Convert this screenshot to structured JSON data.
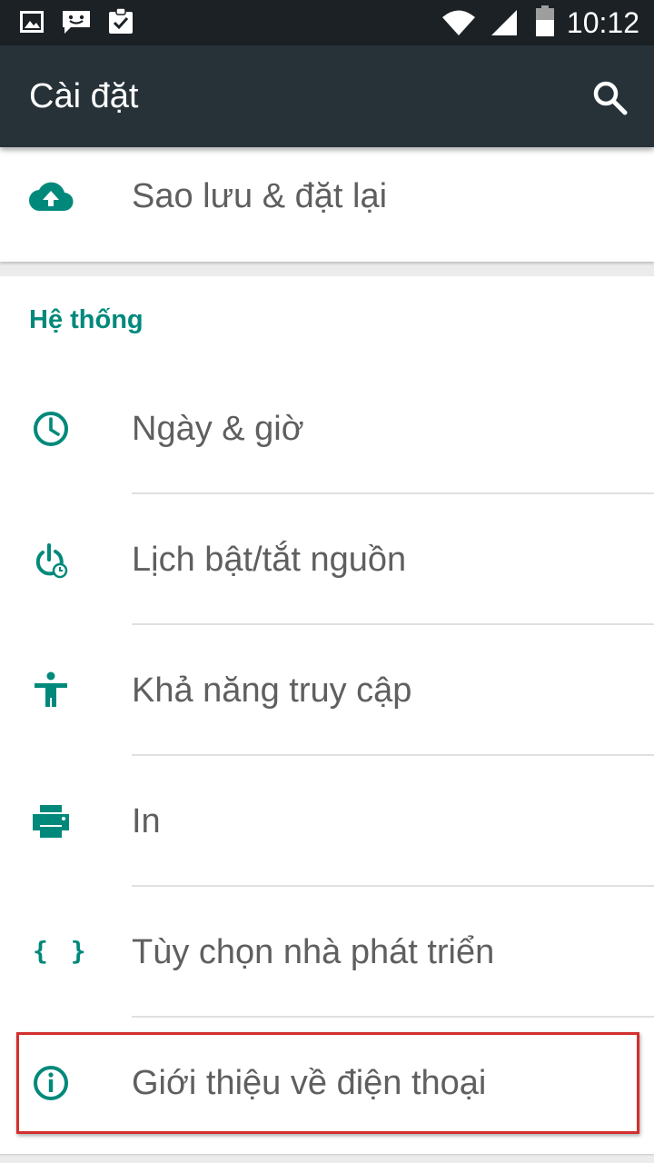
{
  "status_bar": {
    "time": "10:12",
    "left_icons": [
      "image-icon",
      "messenger-icon",
      "clipboard-check-icon"
    ],
    "right_icons": [
      "wifi-icon",
      "signal-icon",
      "battery-icon"
    ]
  },
  "app_bar": {
    "title": "Cài đặt",
    "search_icon": "search-icon"
  },
  "backup_item": {
    "label": "Sao lưu & đặt lại",
    "icon": "cloud-upload-icon"
  },
  "system": {
    "header": "Hệ thống",
    "items": [
      {
        "label": "Ngày & giờ",
        "icon": "clock-icon"
      },
      {
        "label": "Lịch bật/tắt nguồn",
        "icon": "power-schedule-icon"
      },
      {
        "label": "Khả năng truy cập",
        "icon": "accessibility-icon"
      },
      {
        "label": "In",
        "icon": "printer-icon"
      },
      {
        "label": "Tùy chọn nhà phát triển",
        "icon": "developer-braces-icon",
        "glyph": "{ }"
      },
      {
        "label": "Giới thiệu về điện thoại",
        "icon": "info-icon",
        "highlighted": true
      }
    ]
  },
  "colors": {
    "accent": "#00897b",
    "app_bar": "#263238",
    "status_bar": "#1b2125",
    "highlight_border": "#d32f2f"
  }
}
